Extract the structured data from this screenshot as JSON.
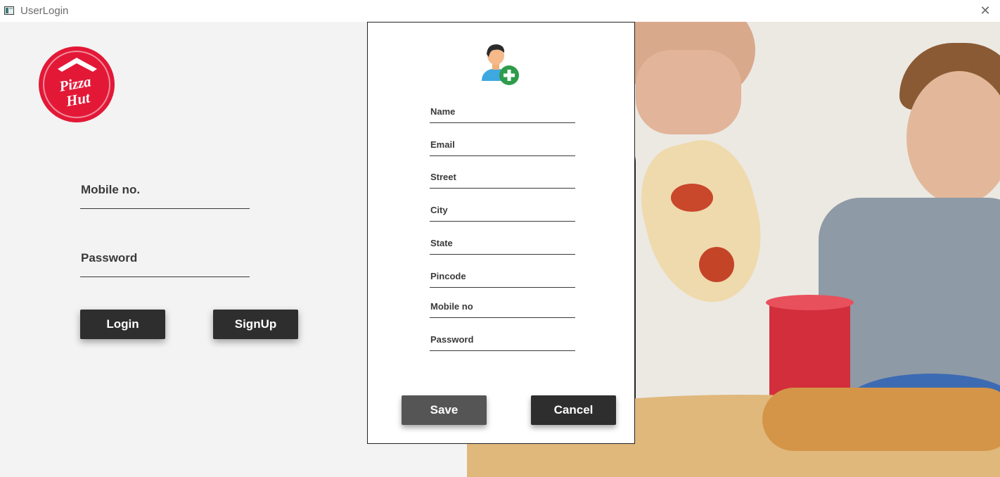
{
  "window": {
    "title": "UserLogin",
    "close_glyph": "✕"
  },
  "brand": {
    "logo_line1": "Pizza",
    "logo_line2": "Hut",
    "logo_color": "#e31837"
  },
  "login": {
    "mobile_label": "Mobile no.",
    "password_label": "Password",
    "login_button": "Login",
    "signup_button": "SignUp"
  },
  "signup_dialog": {
    "icon": "add-user-icon",
    "fields": [
      "Name",
      "Email",
      "Street",
      "City",
      "State",
      "Pincode",
      "Mobile no",
      "Password"
    ],
    "save_button": "Save",
    "cancel_button": "Cancel"
  },
  "colors": {
    "button_dark": "#2e2e2e",
    "button_save": "#555555",
    "accent_green": "#2e9c4a"
  }
}
